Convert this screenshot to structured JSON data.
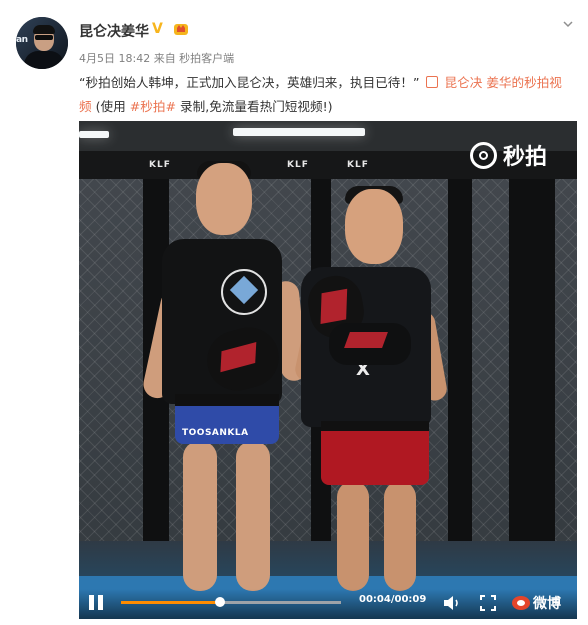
{
  "user": {
    "name": "昆仑决姜华",
    "verified_label": "V",
    "avatar_text": "an"
  },
  "post": {
    "meta": "4月5日 18:42 来自 秒拍客户端",
    "text_prefix": "“秒拍创始人韩坤，正式加入昆仑决，英雄归来，执目已待！”",
    "video_link": "昆仑决 姜华的秒拍视频",
    "text_suffix": "(使用",
    "hashtag": "#秒拍#",
    "text_end": "录制,免流量看热门短视频!)"
  },
  "video": {
    "watermark": "秒拍",
    "time": "00:04/00:09",
    "brand": "微博",
    "progress": 0.45,
    "cage_text_1": "KLF",
    "cage_text_2": "KLF",
    "cage_text_3": "KLF",
    "shorts_text": "TOOSANKLA"
  },
  "colors": {
    "accent": "#eb7350",
    "verified": "#f7b51e",
    "progress": "#ff8c00"
  }
}
